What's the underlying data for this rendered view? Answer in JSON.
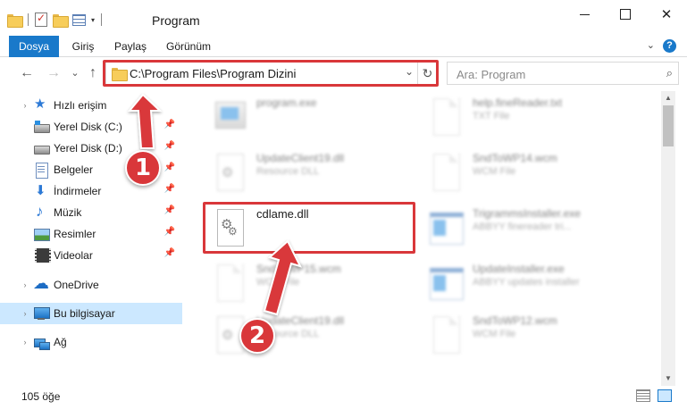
{
  "window": {
    "title": "Program",
    "minimize": "",
    "maximize": "",
    "close": "✕"
  },
  "ribbon": {
    "tabs": [
      {
        "label": "Dosya"
      },
      {
        "label": "Giriş"
      },
      {
        "label": "Paylaş"
      },
      {
        "label": "Görünüm"
      }
    ],
    "help": "?",
    "expand": "⌄"
  },
  "nav": {
    "back": "←",
    "forward": "→",
    "recent": "⌄",
    "up": "↑",
    "address": "C:\\Program Files\\Program Dizini",
    "address_dropdown": "⌄",
    "refresh": "↻",
    "search_placeholder": "Ara: Program",
    "search_icon": "⌕"
  },
  "sidebar": {
    "items": [
      {
        "label": "Hızlı erişim",
        "icon": "star-icon"
      },
      {
        "label": "Yerel Disk (C:)",
        "icon": "disk-icon",
        "pinned": true
      },
      {
        "label": "Yerel Disk (D:)",
        "icon": "disk-icon",
        "pinned": true
      },
      {
        "label": "Belgeler",
        "icon": "document-icon",
        "pinned": true
      },
      {
        "label": "İndirmeler",
        "icon": "download-icon",
        "pinned": true
      },
      {
        "label": "Müzik",
        "icon": "music-icon",
        "pinned": true
      },
      {
        "label": "Resimler",
        "icon": "picture-icon",
        "pinned": true
      },
      {
        "label": "Videolar",
        "icon": "video-icon",
        "pinned": true
      },
      {
        "label": "OneDrive",
        "icon": "cloud-icon"
      },
      {
        "label": "Bu bilgisayar",
        "icon": "computer-icon",
        "selected": true
      },
      {
        "label": "Ağ",
        "icon": "network-icon"
      }
    ],
    "pin_glyph": "📌"
  },
  "files": [
    {
      "name": "program.exe",
      "type": ""
    },
    {
      "name": "help.fineReader.txt",
      "type": "TXT File"
    },
    {
      "name": "UpdateClient19.dll",
      "type": "Resource DLL"
    },
    {
      "name": "SndToWP14.wcm",
      "type": "WCM File"
    },
    {
      "name": "cdlame.dll",
      "type": ""
    },
    {
      "name": "TrigrammsInstaller.exe",
      "type": "ABBYY finereader tri..."
    },
    {
      "name": "SndToWP15.wcm",
      "type": "WCM File"
    },
    {
      "name": "UpdateInstaller.exe",
      "type": "ABBYY updates installer"
    },
    {
      "name": "UpdateClient19.dll",
      "type": "Resource DLL"
    },
    {
      "name": "SndToWP12.wcm",
      "type": "WCM File"
    }
  ],
  "callouts": {
    "step1": "1",
    "step2": "2"
  },
  "colors": {
    "accent": "#1979ca",
    "callout": "#d9373a",
    "selection": "#cce8ff"
  },
  "scroll": {
    "up": "▲",
    "down": "▼"
  },
  "status": {
    "count": "105 öğe"
  }
}
